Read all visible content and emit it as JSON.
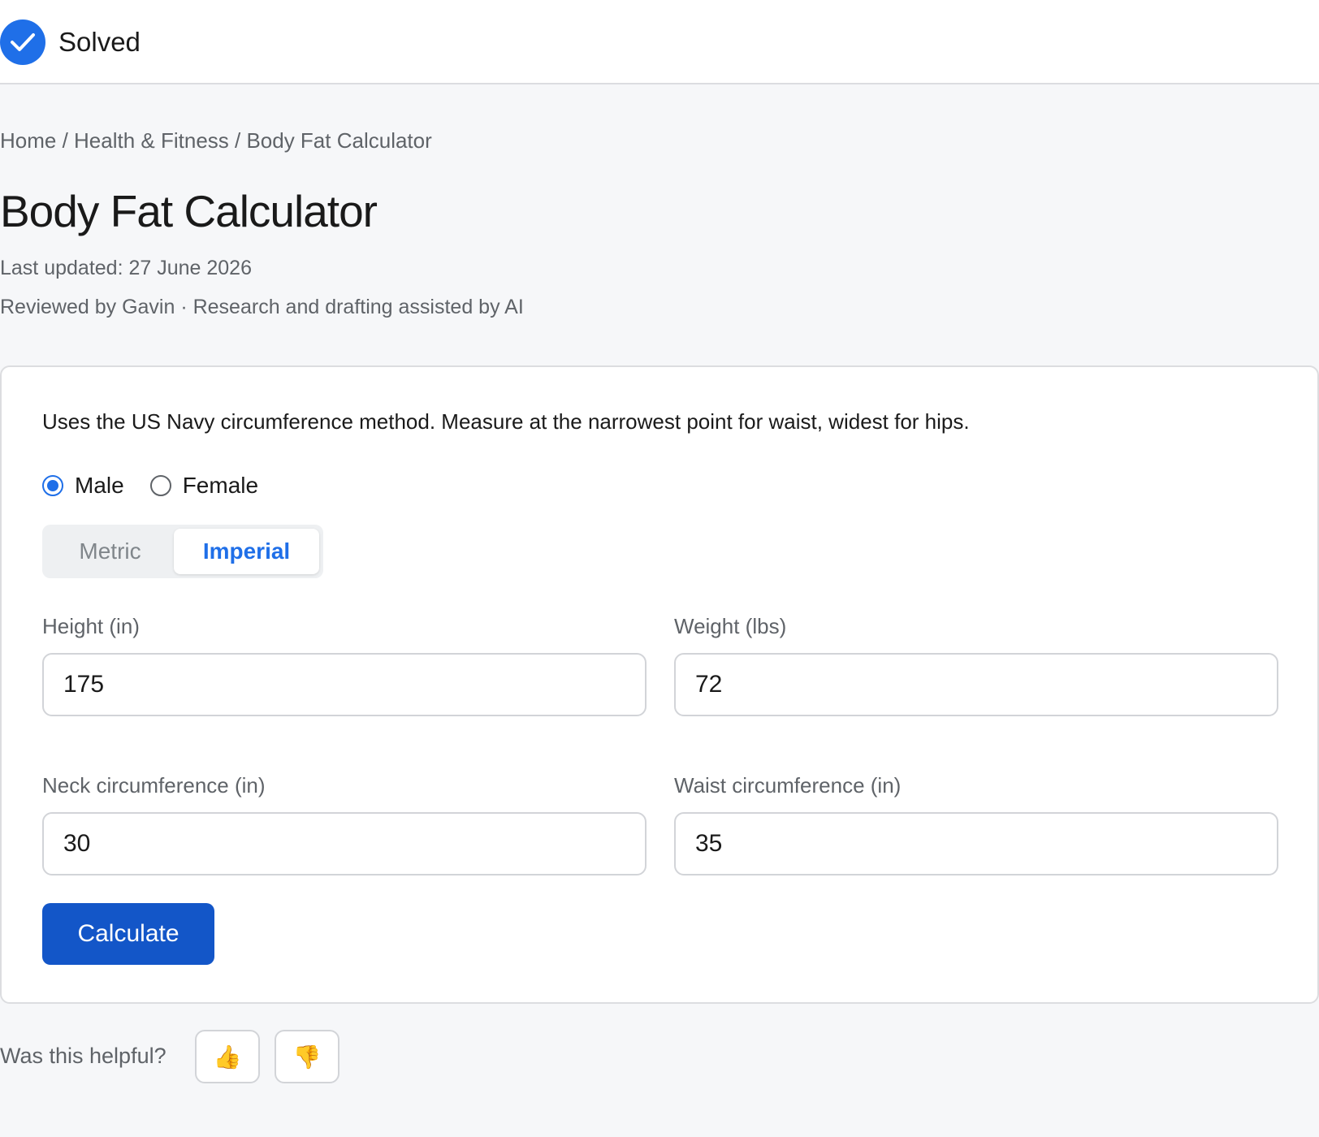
{
  "header": {
    "status_label": "Solved",
    "status_icon": "check-circle-icon",
    "accent_color": "#1f6fe8"
  },
  "breadcrumb": {
    "text": "Home / Health & Fitness / Body Fat Calculator"
  },
  "page": {
    "title": "Body Fat Calculator",
    "last_updated": "Last updated: 27 June 2026",
    "reviewed_by": "Reviewed by Gavin · Research and drafting assisted by AI"
  },
  "calculator": {
    "intro": "Uses the US Navy circumference method. Measure at the narrowest point for waist, widest for hips.",
    "sex_options": {
      "male": "Male",
      "female": "Female",
      "selected": "Male"
    },
    "unit_options": {
      "metric": "Metric",
      "imperial": "Imperial",
      "selected": "Imperial"
    },
    "fields": {
      "height": {
        "label": "Height (in)",
        "value": "175"
      },
      "weight": {
        "label": "Weight (lbs)",
        "value": "72"
      },
      "neck": {
        "label": "Neck circumference (in)",
        "value": "30"
      },
      "waist": {
        "label": "Waist circumference (in)",
        "value": "35"
      }
    },
    "calculate_label": "Calculate",
    "button_color": "#1356c8"
  },
  "feedback": {
    "question": "Was this helpful?",
    "thumbs_up": "👍",
    "thumbs_down": "👎"
  }
}
